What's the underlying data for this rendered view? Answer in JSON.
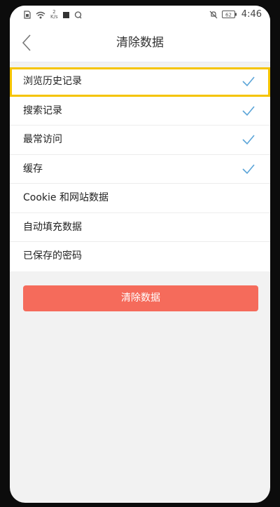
{
  "status_bar": {
    "net_speed_value": "2",
    "net_speed_unit": "K/s",
    "battery_text": "62",
    "time": "4:46"
  },
  "header": {
    "title": "清除数据"
  },
  "options": [
    {
      "label": "浏览历史记录",
      "checked": true
    },
    {
      "label": "搜索记录",
      "checked": true
    },
    {
      "label": "最常访问",
      "checked": true
    },
    {
      "label": "缓存",
      "checked": true
    },
    {
      "label": "Cookie 和网站数据",
      "checked": false
    },
    {
      "label": "自动填充数据",
      "checked": false
    },
    {
      "label": "已保存的密码",
      "checked": false
    }
  ],
  "clear_button": {
    "label": "清除数据"
  },
  "colors": {
    "accent_check": "#5aa4d8",
    "clear_button": "#f56b5b",
    "highlight_outline": "#f5c400"
  },
  "icons": {
    "back": "chevron-left-icon",
    "check": "check-icon"
  }
}
